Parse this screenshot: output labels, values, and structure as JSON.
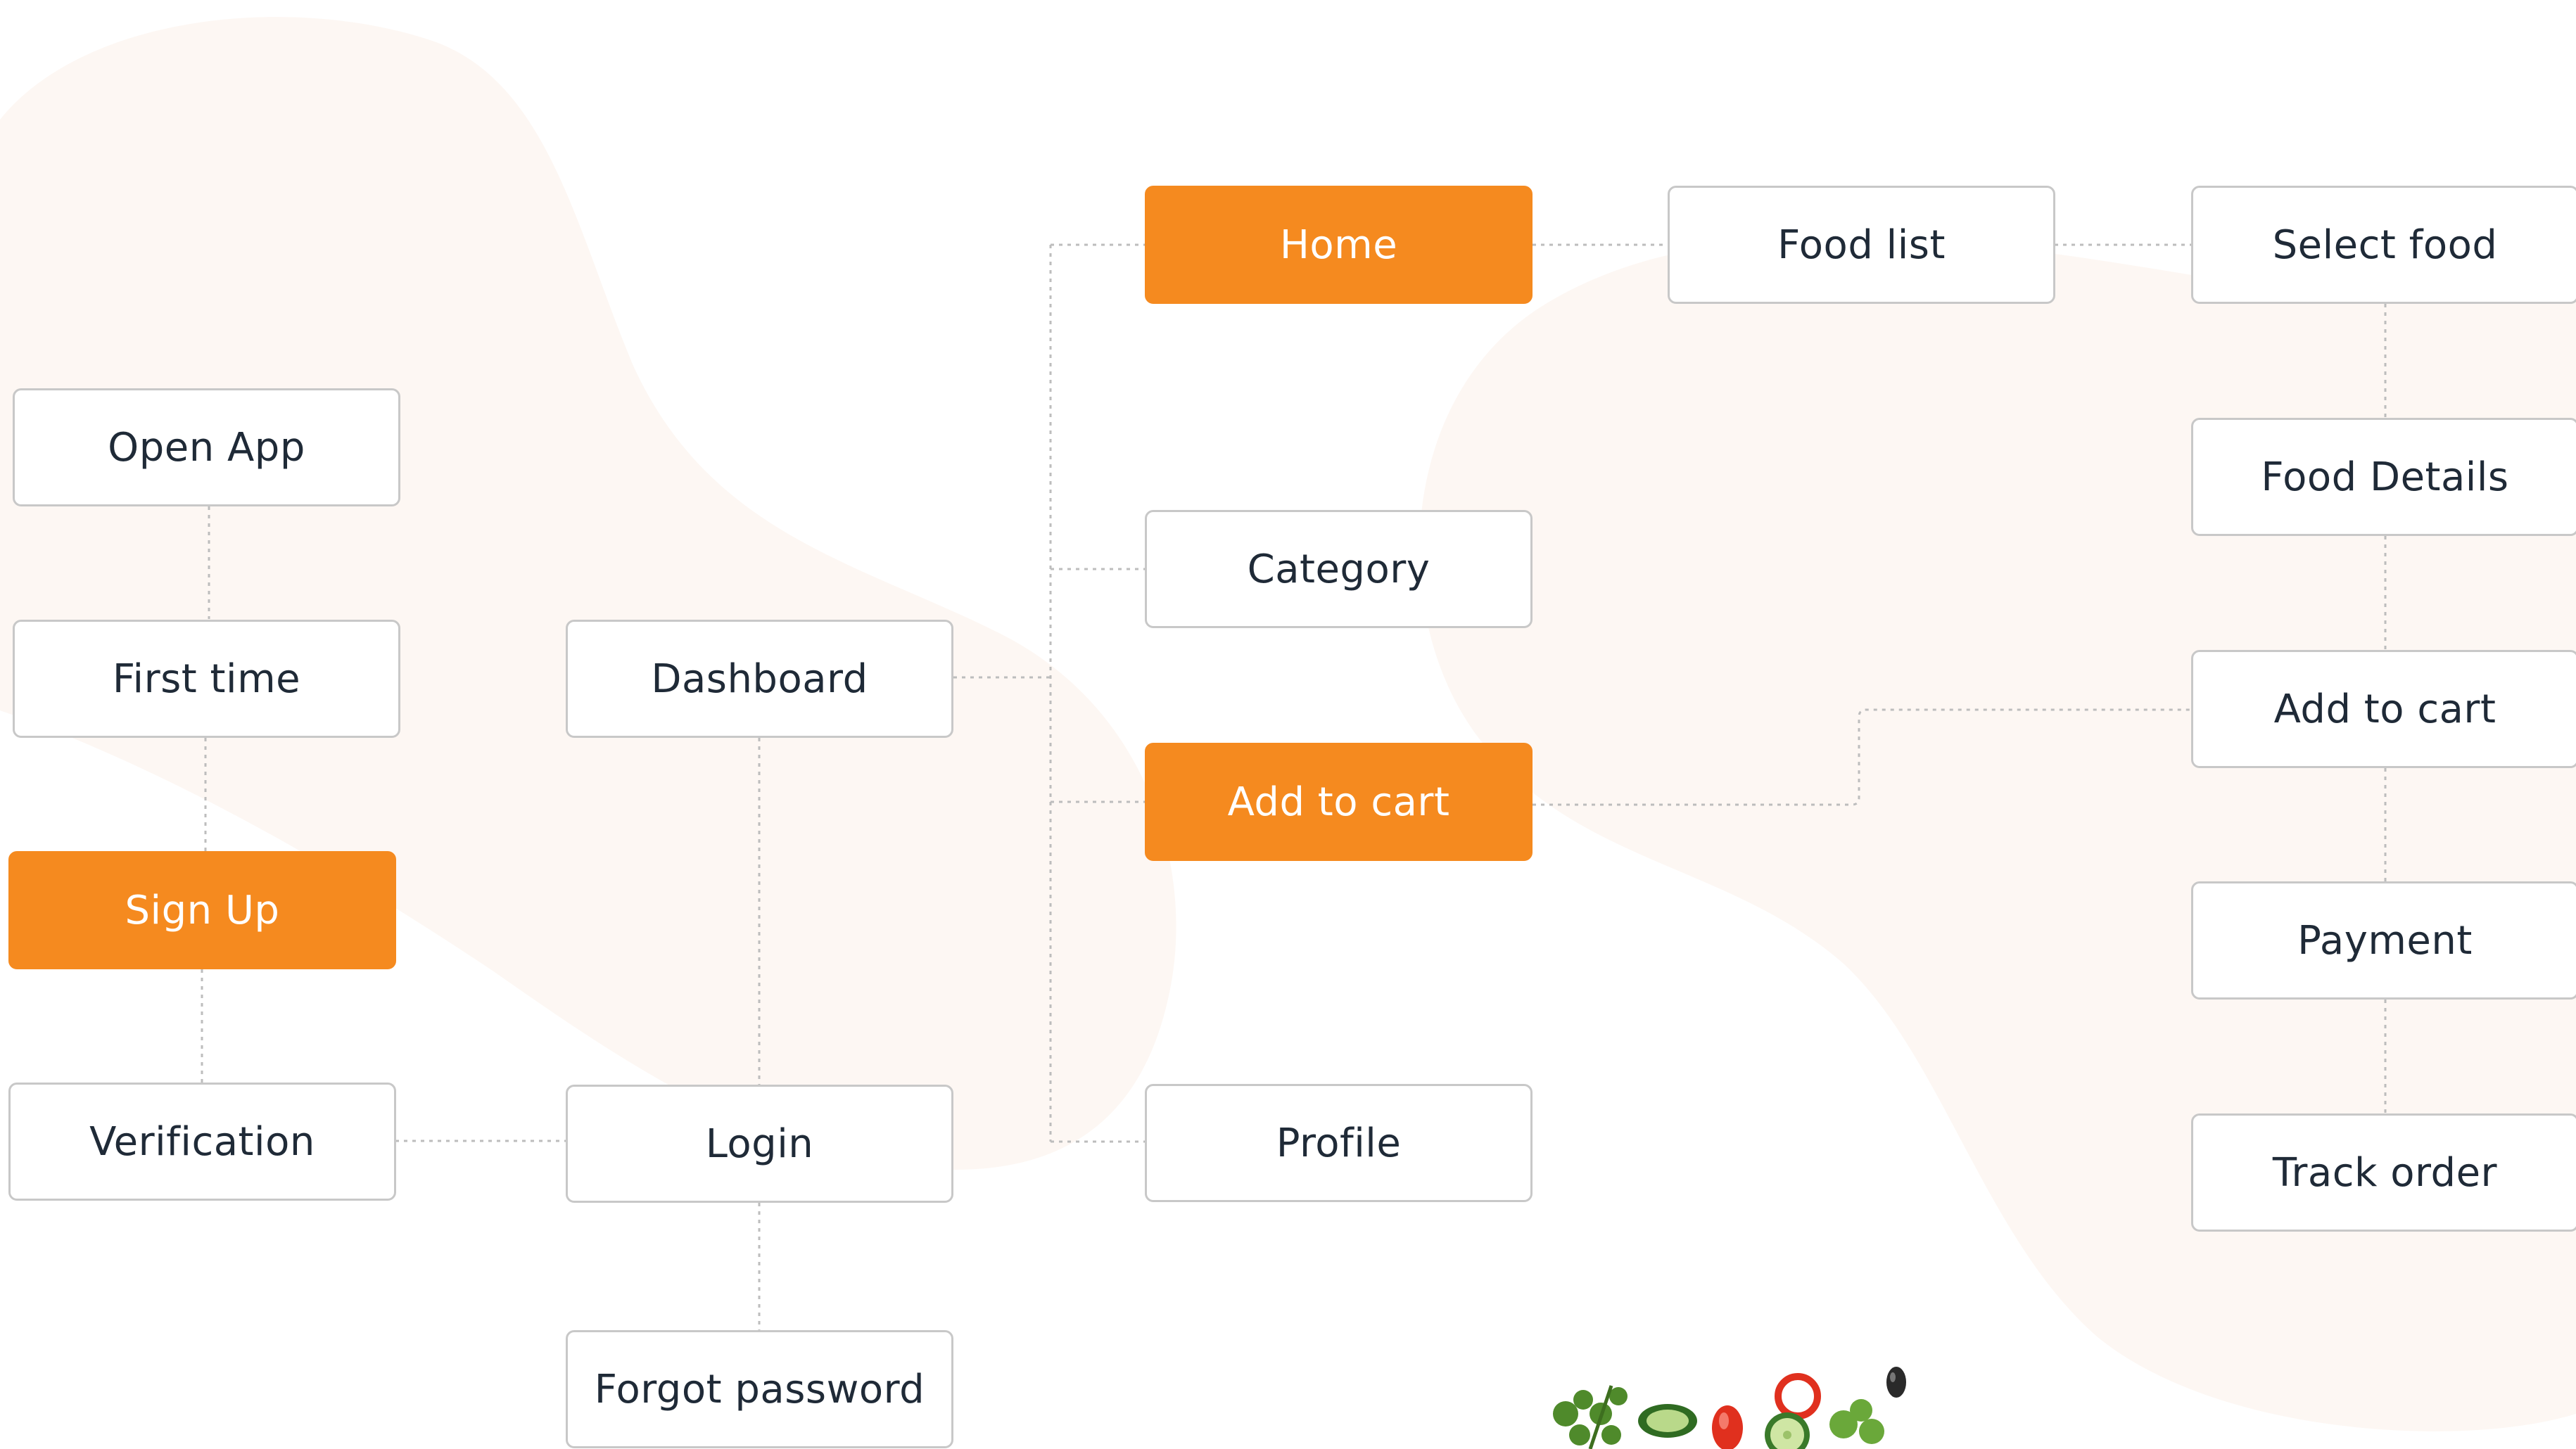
{
  "colors": {
    "accent": "#F58A1F",
    "node_border": "#c8c8c8",
    "node_text": "#1f2a37",
    "connector": "#bdbdbd",
    "background_blob": "#fdf6f2"
  },
  "nodes": {
    "open_app": "Open App",
    "first_time": "First time",
    "sign_up": "Sign Up",
    "verification": "Verification",
    "dashboard": "Dashboard",
    "login": "Login",
    "forgot_password": "Forgot password",
    "home": "Home",
    "category": "Category",
    "add_to_cart_mid": "Add to cart",
    "profile": "Profile",
    "food_list": "Food list",
    "select_food": "Select food",
    "food_details": "Food Details",
    "add_to_cart_right": "Add to cart",
    "payment": "Payment",
    "track_order": "Track order"
  },
  "decoration": {
    "bottom_image": "vegetables-illustration"
  }
}
